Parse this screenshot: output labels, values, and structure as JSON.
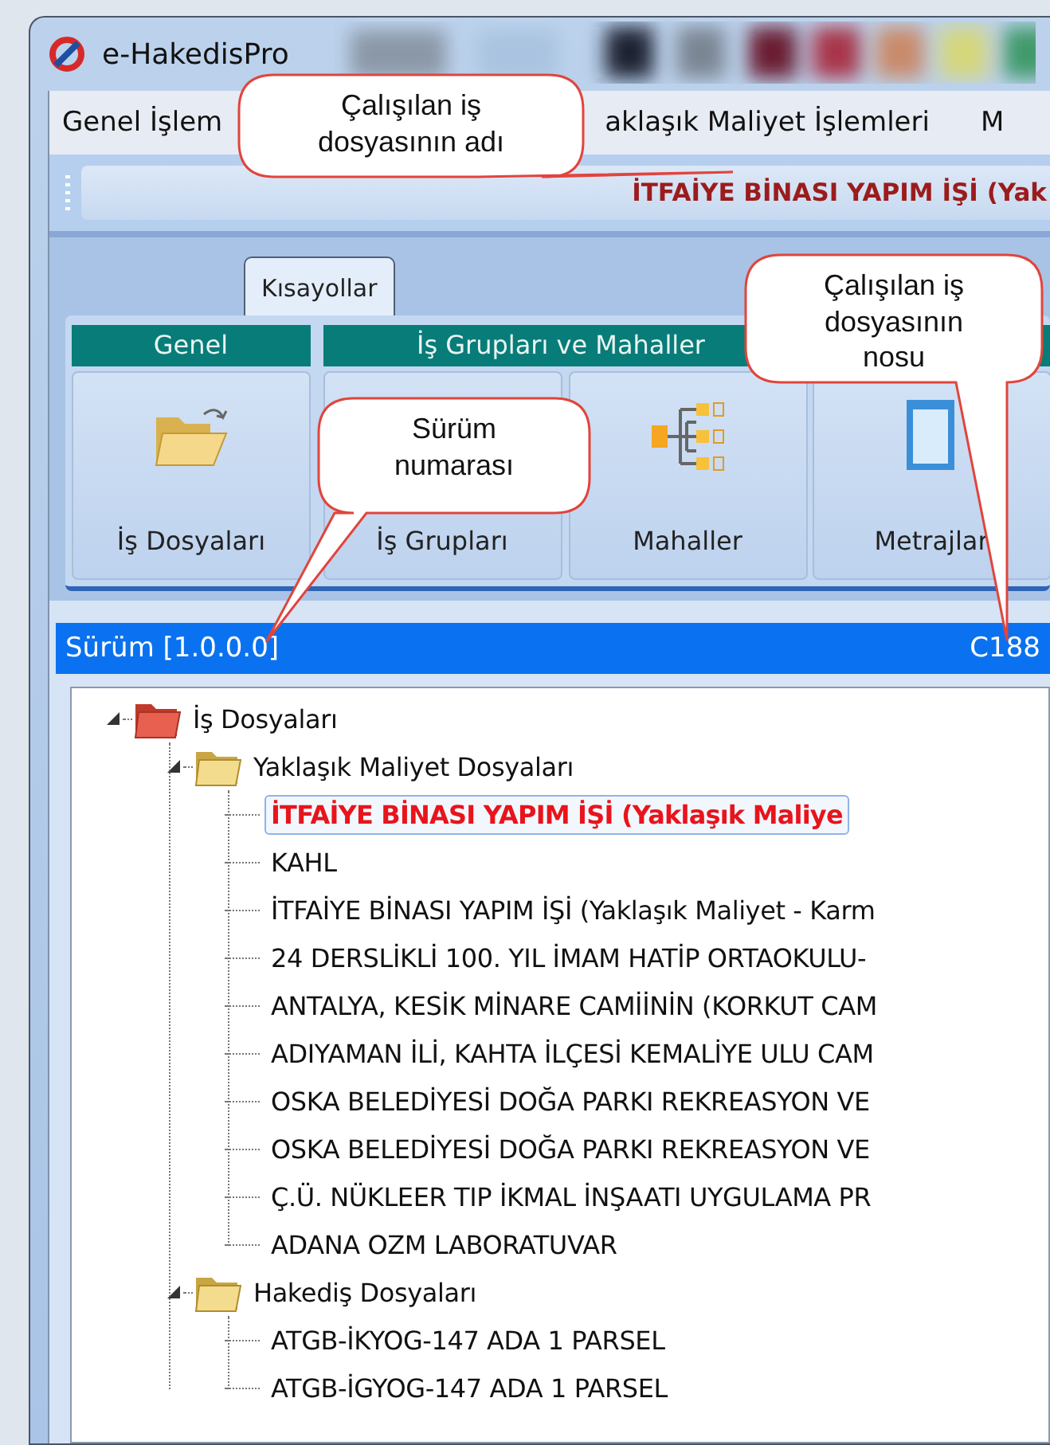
{
  "window": {
    "title": "e-HakedisPro"
  },
  "menu": [
    "Genel İşlem",
    "aklaşık Maliyet İşlemleri",
    "M"
  ],
  "toolbar": {
    "current_file": "İTFAİYE BİNASI YAPIM İŞİ (Yak"
  },
  "ribbon": {
    "tabs": [
      {
        "label": "Kısayollar",
        "selected": true
      }
    ],
    "groups": [
      {
        "title": "Genel",
        "buttons": [
          {
            "label": "İş Dosyaları",
            "kind": "folder"
          }
        ]
      },
      {
        "title": "İş Grupları ve Mahaller",
        "buttons": [
          {
            "label": "İş Grupları",
            "kind": "hidden"
          },
          {
            "label": "Mahaller",
            "kind": "hierarchy"
          }
        ]
      },
      {
        "buttons": [
          {
            "label": "Metrajlar",
            "kind": "document"
          }
        ]
      }
    ]
  },
  "panel": {
    "version": "Sürüm [1.0.0.0]",
    "file_no": "C188"
  },
  "tree": [
    {
      "label": "İş Dosyaları",
      "kind": "cabinet",
      "expanded": true,
      "selected": false,
      "children": [
        {
          "label": "Yaklaşık Maliyet Dosyaları",
          "kind": "folder",
          "expanded": true,
          "selected": false,
          "children": [
            {
              "label": "İTFAİYE BİNASI YAPIM İŞİ (Yaklaşık Maliye",
              "selected": true
            },
            {
              "label": "KAHL",
              "selected": false
            },
            {
              "label": "İTFAİYE BİNASI YAPIM İŞİ (Yaklaşık Maliyet - Karm",
              "selected": false
            },
            {
              "label": "24 DERSLİKLİ 100. YIL İMAM HATİP ORTAOKULU-",
              "selected": false
            },
            {
              "label": "ANTALYA, KESİK MİNARE CAMİİNİN (KORKUT CAM",
              "selected": false
            },
            {
              "label": "ADIYAMAN İLİ, KAHTA İLÇESİ KEMALİYE ULU CAM",
              "selected": false
            },
            {
              "label": "OSKA BELEDİYESİ DOĞA PARKI REKREASYON VE",
              "selected": false
            },
            {
              "label": "OSKA BELEDİYESİ DOĞA PARKI REKREASYON VE",
              "selected": false
            },
            {
              "label": "Ç.Ü. NÜKLEER TIP İKMAL İNŞAATI UYGULAMA PR",
              "selected": false
            },
            {
              "label": "ADANA OZM LABORATUVAR",
              "selected": false
            }
          ]
        },
        {
          "label": "Hakediş Dosyaları",
          "kind": "folder",
          "expanded": true,
          "selected": false,
          "children": [
            {
              "label": "ATGB-İKYOG-147 ADA 1 PARSEL",
              "selected": false
            },
            {
              "label": "ATGB-İGYOG-147 ADA 1 PARSEL",
              "selected": false
            }
          ]
        }
      ]
    }
  ],
  "callouts": [
    "Çalışılan iş dosyasının adı",
    "Çalışılan iş dosyasının nosu",
    "Sürüm numarası"
  ]
}
